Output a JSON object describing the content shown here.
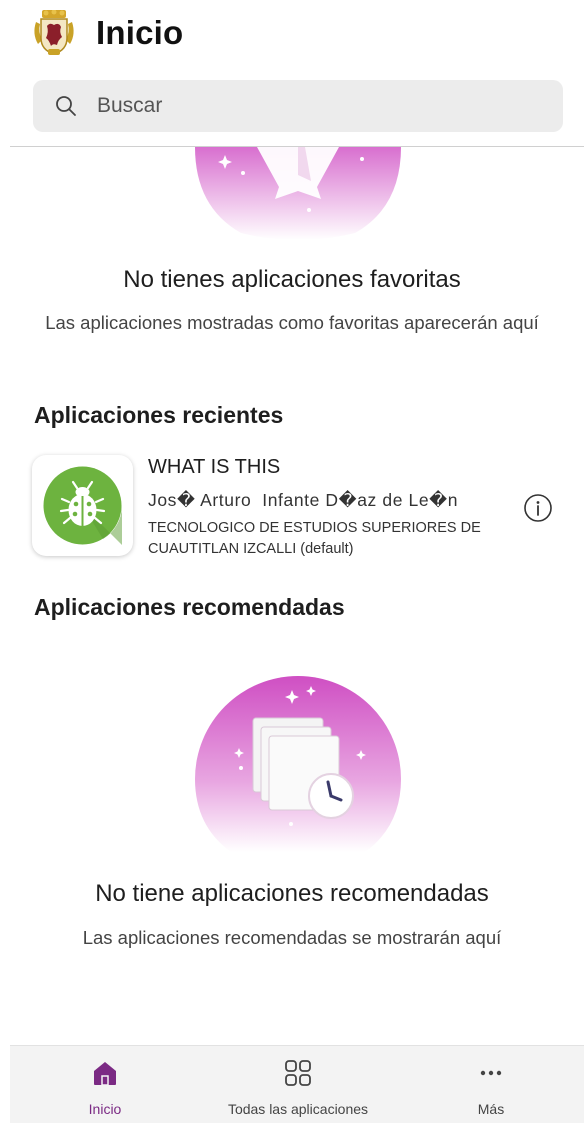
{
  "header": {
    "title": "Inicio",
    "logo_icon": "coat-of-arms-icon"
  },
  "search": {
    "placeholder": "Buscar",
    "icon": "search-icon"
  },
  "favorites": {
    "title": "No tienes aplicaciones favoritas",
    "subtitle": "Las aplicaciones mostradas como favoritas aparecerán aquí",
    "illustration": "star-illustration"
  },
  "recent": {
    "title": "Aplicaciones recientes",
    "items": [
      {
        "name": "WHAT IS THIS",
        "author": "Jos� Arturo  Infante D�az de Le�n",
        "organization": "TECNOLOGICO DE ESTUDIOS SUPERIORES DE CUAUTITLAN IZCALLI (default)",
        "icon": "bug-icon",
        "icon_color": "#6db33f"
      }
    ]
  },
  "recommended": {
    "title": "Aplicaciones recomendadas",
    "empty_title": "No tiene aplicaciones recomendadas",
    "empty_subtitle": "Las aplicaciones recomendadas se mostrarán aquí",
    "illustration": "apps-clock-illustration"
  },
  "bottom_nav": {
    "items": [
      {
        "label": "Inicio",
        "icon": "home-icon",
        "active": true
      },
      {
        "label": "Todas las aplicaciones",
        "icon": "grid-icon",
        "active": false
      },
      {
        "label": "Más",
        "icon": "more-icon",
        "active": false
      }
    ]
  },
  "colors": {
    "accent": "#7b2a84",
    "illustration_pink": "#d86fcf",
    "search_bg": "#ececec"
  }
}
